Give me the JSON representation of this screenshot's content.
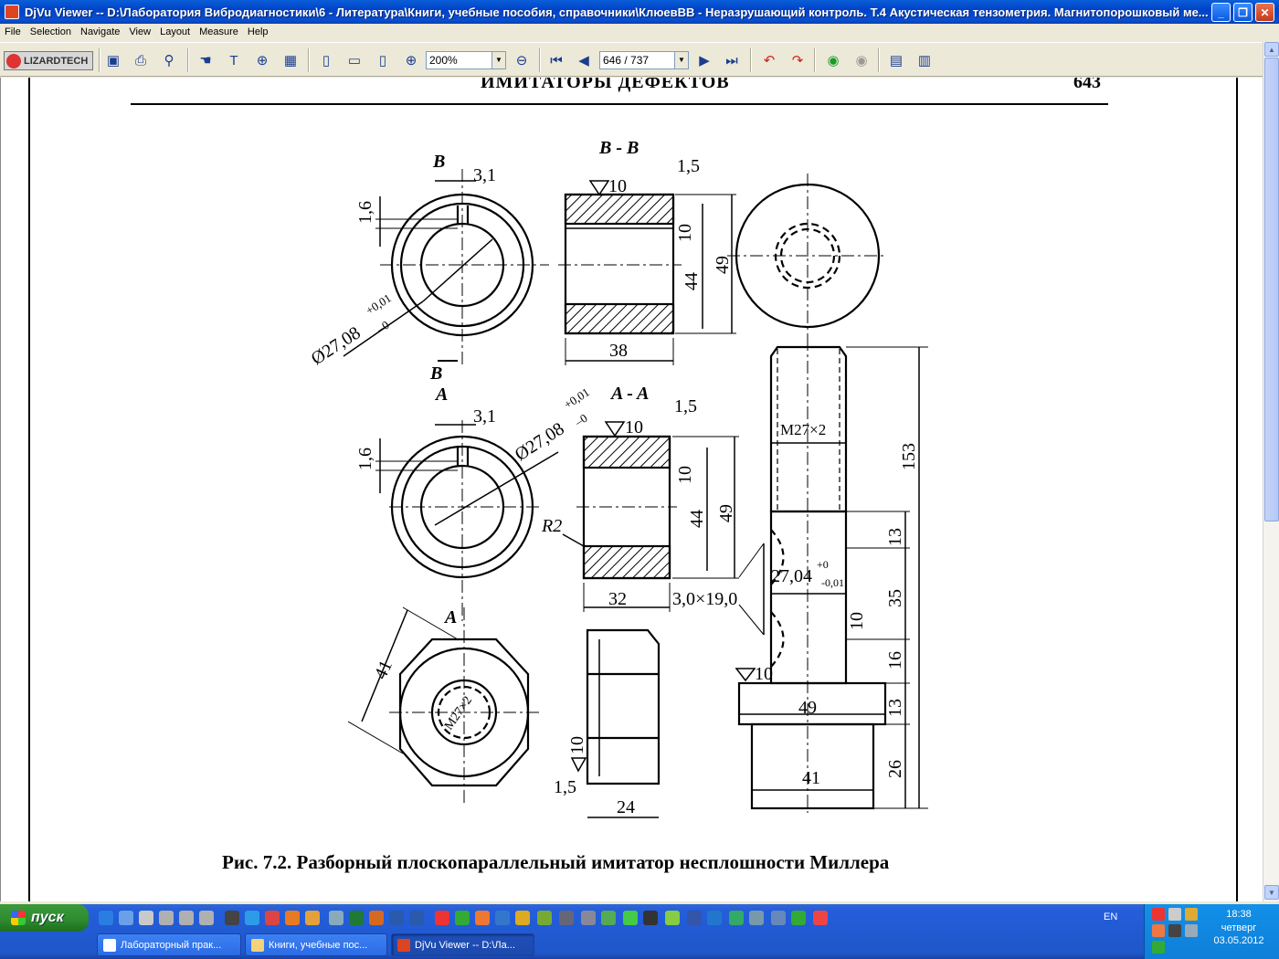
{
  "window": {
    "title": "DjVu Viewer -- D:\\Лаборатория Вибродиагностики\\6 - Литература\\Книги, учебные пособия, справочники\\КлюевВВ - Неразрушающий контроль. Т.4 Акустическая тензометрия. Магнитопорошковый ме..."
  },
  "menu": [
    "File",
    "Selection",
    "Navigate",
    "View",
    "Layout",
    "Measure",
    "Help"
  ],
  "toolbar": {
    "logo": "LIZARDTECH",
    "zoom": "200%",
    "page": "646 / 737"
  },
  "page": {
    "running_head": "ИМИТАТОРЫ ДЕФЕКТОВ",
    "page_number": "643",
    "caption": "Рис. 7.2. Разборный плоскопараллельный имитатор несплошности Миллера",
    "dims": {
      "b": "B",
      "a": "A",
      "bb": "B - B",
      "aa": "A - A",
      "d31": "3,1",
      "d16": "1,6",
      "d15": "1,5",
      "d10": "10",
      "d49": "49",
      "d44": "44",
      "d38": "38",
      "d32": "32",
      "d24": "24",
      "d41": "41",
      "d153": "153",
      "d13": "13",
      "d35": "35",
      "d26": "26",
      "dia": "Ø27,08",
      "tol_top": "+0,01",
      "tol_bot": "–0",
      "r2": "R2",
      "m27": "M27×2",
      "chamfer": "3,0×19,0",
      "d2704": "27,04",
      "tol2_top": "+0",
      "tol2_bot": "-0,01"
    }
  },
  "taskbar": {
    "start": "пуск",
    "lang": "EN",
    "time": "18:38",
    "day": "четверг",
    "date": "03.05.2012",
    "tasks": [
      "Лабораторный прак...",
      "Книги, учебные пос...",
      "DjVu Viewer -- D:\\Ла..."
    ]
  }
}
